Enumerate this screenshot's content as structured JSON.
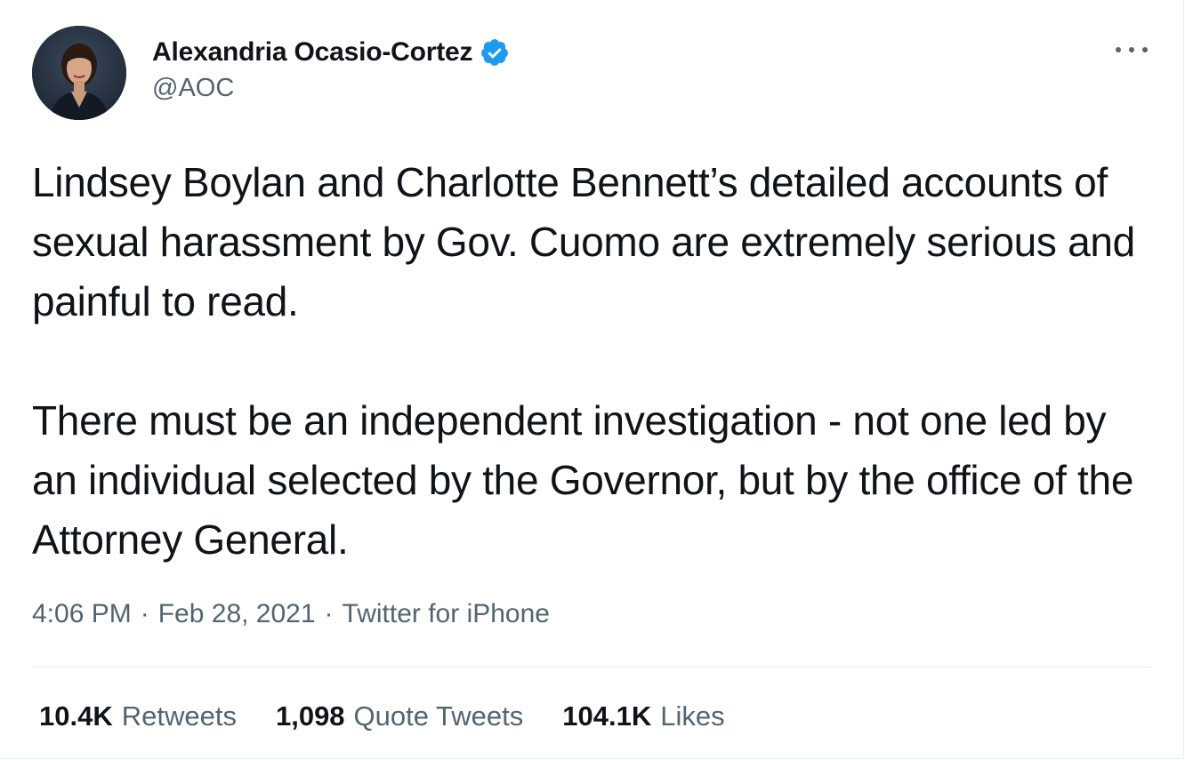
{
  "tweet": {
    "author": {
      "display_name": "Alexandria Ocasio-Cortez",
      "handle": "@AOC",
      "verified": true,
      "verified_color": "#1d9bf0",
      "avatar_icon": "profile-photo"
    },
    "more_icon": "more-horizontal-icon",
    "text": {
      "paragraph_1": "Lindsey Boylan and Charlotte Bennett’s detailed accounts of sexual harassment by Gov. Cuomo are extremely serious and painful to read.",
      "paragraph_2": "There must be an independent investigation - not one led by an individual selected by the Governor, but by the office of the Attorney General."
    },
    "meta": {
      "time": "4:06 PM",
      "date": "Feb 28, 2021",
      "source": "Twitter for iPhone",
      "separator": "·"
    },
    "stats": {
      "retweets": {
        "count": "10.4K",
        "label": "Retweets"
      },
      "quote_tweets": {
        "count": "1,098",
        "label": "Quote Tweets"
      },
      "likes": {
        "count": "104.1K",
        "label": "Likes"
      }
    },
    "colors": {
      "primary_text": "#0f1419",
      "secondary_text": "#536471",
      "divider": "#e6ecf0"
    }
  }
}
